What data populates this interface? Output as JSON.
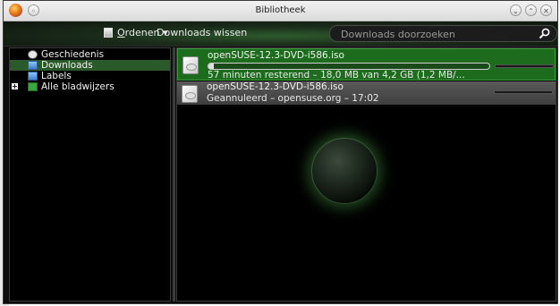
{
  "window": {
    "title": "Bibliotheek"
  },
  "toolbar": {
    "organize_label": "Ordenen",
    "organize_mnemonic": "O",
    "organize_rest": "rdenen",
    "organize_arrow": "▾",
    "clear_label": "Downloads wissen",
    "search_placeholder": "Downloads doorzoeken"
  },
  "sidebar": {
    "items": [
      {
        "label": "Geschiedenis",
        "icon": "clock-icon",
        "selected": false,
        "expandable": false
      },
      {
        "label": "Downloads",
        "icon": "folder-icon",
        "selected": true,
        "expandable": false
      },
      {
        "label": "Labels",
        "icon": "folder-icon",
        "selected": false,
        "expandable": false
      },
      {
        "label": "Alle bladwijzers",
        "icon": "bookmark-icon",
        "selected": false,
        "expandable": true
      }
    ],
    "expander_glyph": "+"
  },
  "downloads": [
    {
      "name": "openSUSE-12.3-DVD-i586.iso",
      "status": "57 minuten resterend – 18,0 MB van 4,2 GB (1,2 MB/...",
      "progress": 0.004,
      "state": "downloading"
    },
    {
      "name": "openSUSE-12.3-DVD-i586.iso",
      "status": "Geannuleerd – opensuse.org – 17:02",
      "state": "cancelled"
    }
  ],
  "colors": {
    "selection": "#2a5a2a",
    "active_row": "#1d6b1d",
    "cancelled_row": "#4a4a4a",
    "background": "#000000"
  }
}
